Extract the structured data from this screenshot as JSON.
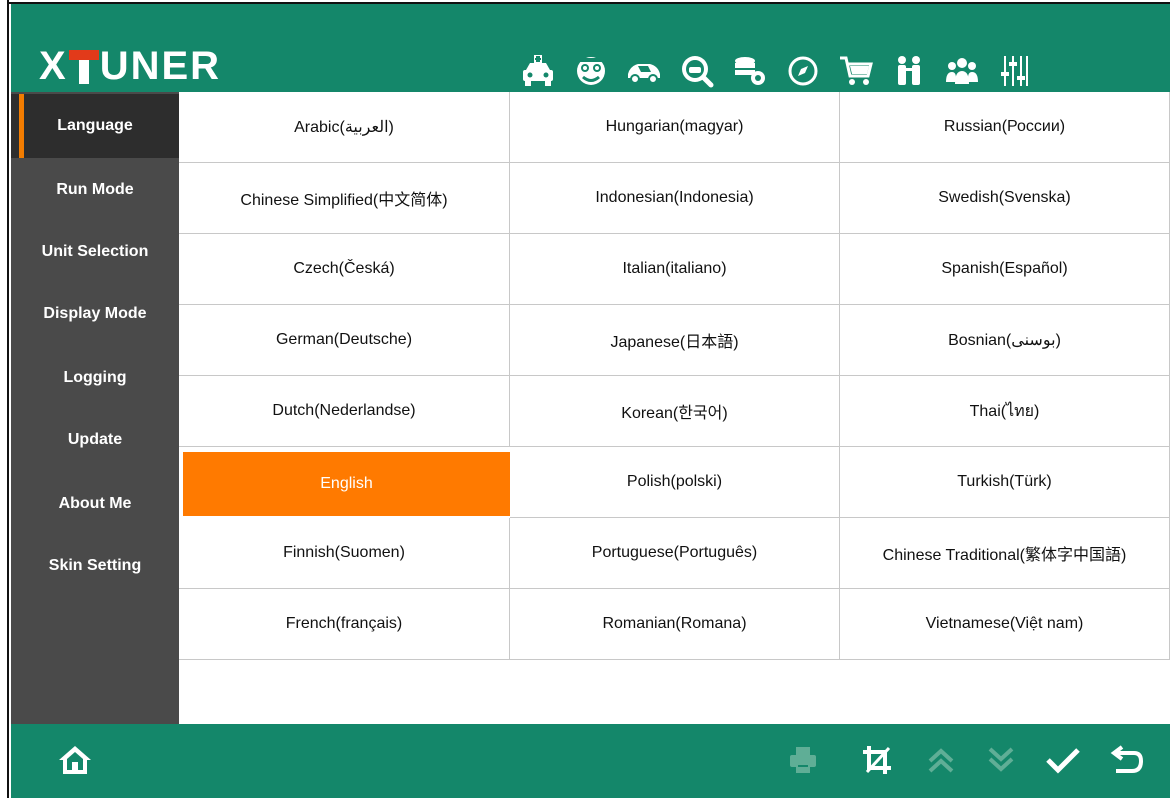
{
  "app": {
    "logo_text_left": "X",
    "logo_text_right": "UNER",
    "brand_color": "#14876a",
    "accent_color": "#ff7a00",
    "logo_accent_color": "#e23a1a"
  },
  "header": {
    "icons": [
      {
        "name": "car-diagnosis-icon"
      },
      {
        "name": "mechanic-icon"
      },
      {
        "name": "car-icon"
      },
      {
        "name": "car-search-icon"
      },
      {
        "name": "data-settings-icon"
      },
      {
        "name": "compass-icon"
      },
      {
        "name": "shopping-cart-icon"
      },
      {
        "name": "users-icon"
      },
      {
        "name": "user-group-icon"
      },
      {
        "name": "sliders-icon"
      }
    ]
  },
  "sidebar": {
    "items": [
      {
        "label": "Language",
        "active": true
      },
      {
        "label": "Run Mode",
        "active": false
      },
      {
        "label": "Unit Selection",
        "active": false
      },
      {
        "label": "Display Mode",
        "active": false
      },
      {
        "label": "Logging",
        "active": false
      },
      {
        "label": "Update",
        "active": false
      },
      {
        "label": "About Me",
        "active": false
      },
      {
        "label": "Skin Setting",
        "active": false
      }
    ]
  },
  "languages": {
    "selected": "English",
    "rows": [
      [
        "Arabic(العربية)",
        "Hungarian(magyar)",
        "Russian(России)"
      ],
      [
        "Chinese Simplified(中文简体)",
        "Indonesian(Indonesia)",
        "Swedish(Svenska)"
      ],
      [
        "Czech(Česká)",
        "Italian(italiano)",
        "Spanish(Español)"
      ],
      [
        "German(Deutsche)",
        "Japanese(日本語)",
        "Bosnian(بوسنى)"
      ],
      [
        "Dutch(Nederlandse)",
        "Korean(한국어)",
        "Thai(ไทย)"
      ],
      [
        "English",
        "Polish(polski)",
        "Turkish(Türk)"
      ],
      [
        "Finnish(Suomen)",
        "Portuguese(Português)",
        "Chinese Traditional(繁体字中国語)"
      ],
      [
        "French(français)",
        "Romanian(Romana)",
        "Vietnamese(Việt nam)"
      ]
    ]
  },
  "footer": {
    "icons": [
      {
        "name": "home-icon",
        "enabled": true
      },
      {
        "name": "print-icon",
        "enabled": false
      },
      {
        "name": "crop-icon",
        "enabled": true
      },
      {
        "name": "page-up-icon",
        "enabled": false
      },
      {
        "name": "page-down-icon",
        "enabled": false
      },
      {
        "name": "confirm-check-icon",
        "enabled": true
      },
      {
        "name": "back-icon",
        "enabled": true
      }
    ]
  }
}
